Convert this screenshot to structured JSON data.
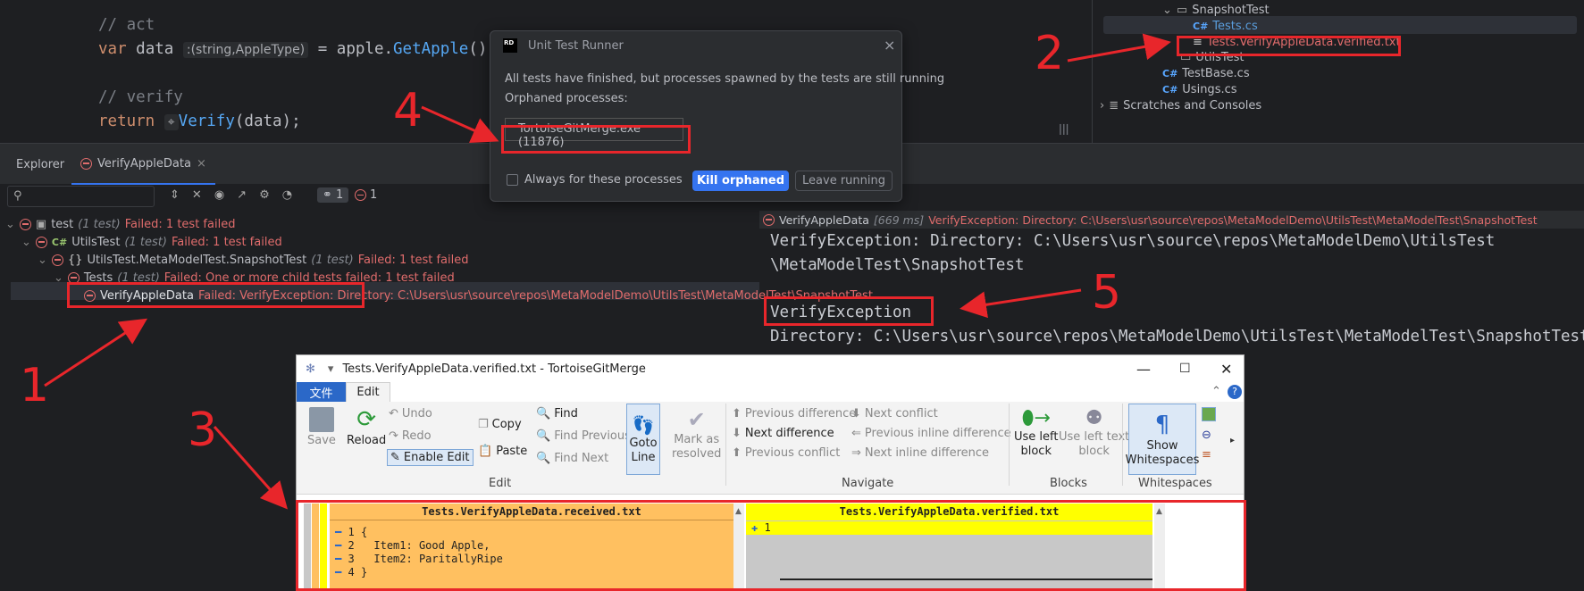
{
  "code": {
    "c1": "// act",
    "l2a": "var",
    "l2b": "data",
    "l2hint": ":(string,AppleType)",
    "l2c": "=",
    "l2d": "apple.",
    "l2e": "GetApple",
    "l2f": "();",
    "c3": "// verify",
    "l4a": "return",
    "l4b": "Verify",
    "l4c": "(data);"
  },
  "project_tree": {
    "items": [
      "SnapshotTest",
      "Tests.cs",
      "Tests.VerifyAppleData.verified.txt",
      "UtilsTest",
      "TestBase.cs",
      "Usings.cs",
      "Scratches and Consoles"
    ],
    "cs_badge": "C#"
  },
  "tabs": [
    "Explorer",
    "VerifyAppleData"
  ],
  "toolbar": {
    "pass_count": "1",
    "fail_count": "1"
  },
  "tests": {
    "rows": [
      {
        "name": "test",
        "meta": "(1 test)",
        "status": "Failed: 1 test failed"
      },
      {
        "name": "UtilsTest",
        "meta": "(1 test)",
        "status": "Failed: 1 test failed"
      },
      {
        "name": "UtilsTest.MetaModelTest.SnapshotTest",
        "meta": "(1 test)",
        "status": "Failed: 1 test failed"
      },
      {
        "name": "Tests",
        "meta": "(1 test)",
        "status": "Failed: One or more child tests failed: 1 test failed"
      },
      {
        "name": "VerifyAppleData",
        "meta": "",
        "status": "Failed: VerifyException: Directory: C:\\Users\\usr\\source\\repos\\MetaModelDemo\\UtilsTest\\MetaModelTest\\SnapshotTest"
      }
    ]
  },
  "output": {
    "header_name": "VerifyAppleData",
    "header_time": "[669 ms]",
    "header_msg": "VerifyException: Directory: C:\\Users\\usr\\source\\repos\\MetaModelDemo\\UtilsTest\\MetaModelTest\\SnapshotTest",
    "line1": "VerifyException: Directory: C:\\Users\\usr\\source\\repos\\MetaModelDemo\\UtilsTest",
    "line2": "\\MetaModelTest\\SnapshotTest",
    "line3": "VerifyException",
    "line4": "Directory: C:\\Users\\usr\\source\\repos\\MetaModelDemo\\UtilsTest\\MetaModelTest\\SnapshotTest"
  },
  "dialog": {
    "title": "Unit Test Runner",
    "msg1": "All tests have finished, but processes spawned by the tests are still running",
    "msg2": "Orphaned processes:",
    "process": "TortoiseGitMerge.exe (11876)",
    "checkbox": "Always for these processes",
    "kill": "Kill orphaned",
    "leave": "Leave running",
    "logo": "RD"
  },
  "annotations": [
    "1",
    "2",
    "3",
    "4",
    "5"
  ],
  "merge": {
    "title": "Tests.VerifyAppleData.verified.txt - TortoiseGitMerge",
    "tab_file": "文件",
    "tab_edit": "Edit",
    "edit": {
      "save": "Save",
      "reload": "Reload",
      "undo": "Undo",
      "redo": "Redo",
      "enable_edit": "Enable Edit",
      "copy": "Copy",
      "paste": "Paste",
      "find": "Find",
      "find_prev": "Find Previous",
      "find_next": "Find Next",
      "goto": "Goto",
      "goto2": "Line",
      "mark": "Mark as",
      "mark2": "resolved"
    },
    "nav": {
      "prev_diff": "Previous difference",
      "next_conflict": "Next conflict",
      "next_diff": "Next difference",
      "prev_inline": "Previous inline difference",
      "prev_conflict": "Previous conflict",
      "next_inline": "Next inline difference"
    },
    "blocks": {
      "use_left": "Use left",
      "use_left2": "block",
      "use_left_text": "Use left text",
      "use_left_text2": "block"
    },
    "ws": {
      "show": "Show",
      "show2": "Whitespaces"
    },
    "groups": [
      "Edit",
      "Navigate",
      "Blocks",
      "Whitespaces"
    ],
    "left_title": "Tests.VerifyAppleData.received.txt",
    "right_title": "Tests.VerifyAppleData.verified.txt",
    "left_lines": [
      {
        "n": "1",
        "t": "{"
      },
      {
        "n": "2",
        "t": "  Item1: Good Apple,"
      },
      {
        "n": "3",
        "t": "  Item2: ParitallyRipe"
      },
      {
        "n": "4",
        "t": "}"
      }
    ],
    "right_lines": [
      {
        "n": "1",
        "t": ""
      }
    ]
  },
  "colors": {
    "accent_red": "#e8262b",
    "left_pane": "#ffc060",
    "right_header": "#ffff00"
  }
}
